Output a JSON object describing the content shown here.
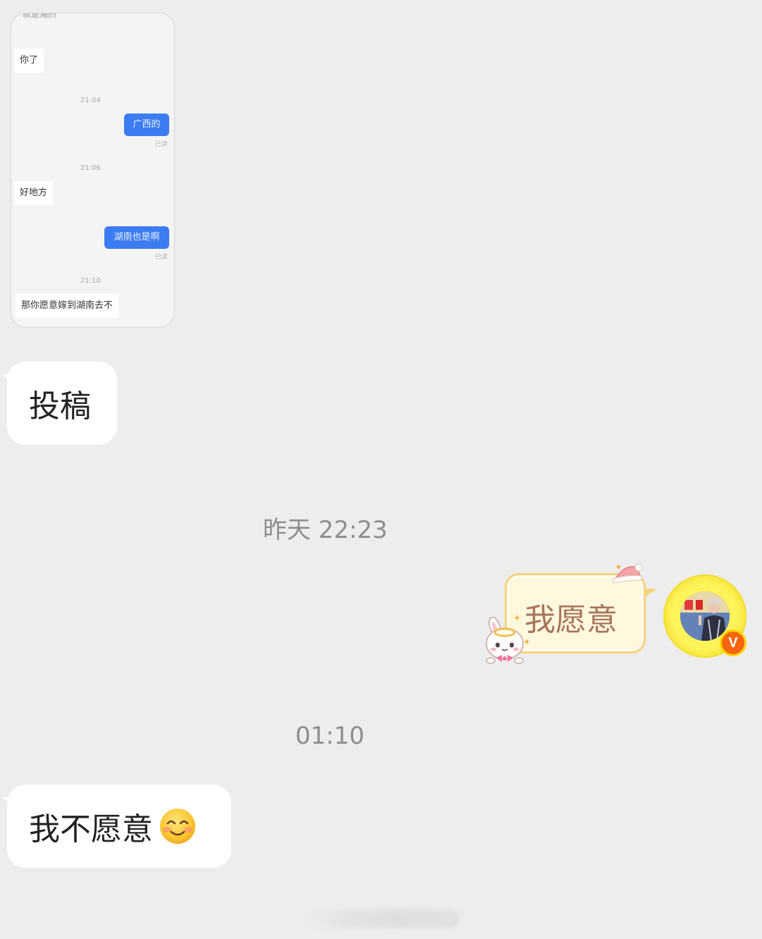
{
  "shared_screenshot": {
    "cut_top_text": "就是湘的",
    "messages": [
      {
        "type": "in",
        "text": "你了"
      },
      {
        "type": "time",
        "text": "21:04"
      },
      {
        "type": "out",
        "text": "广西的",
        "status": "已读"
      },
      {
        "type": "time",
        "text": "21:06"
      },
      {
        "type": "in",
        "text": "好地方"
      },
      {
        "type": "out",
        "text": "湖南也是啊",
        "status": "已读"
      },
      {
        "type": "time",
        "text": "21:10"
      },
      {
        "type": "in",
        "text": "那你愿意嫁到湖南去不"
      }
    ]
  },
  "messages": [
    {
      "type": "in",
      "text": "投稿"
    },
    {
      "type": "time",
      "text": "昨天 22:23"
    },
    {
      "type": "out",
      "text": "我愿意"
    },
    {
      "type": "time",
      "text": "01:10"
    },
    {
      "type": "in",
      "text": "我不愿意"
    }
  ],
  "avatar": {
    "badge": "V"
  },
  "colors": {
    "background": "#ededed",
    "bubble_in": "#ffffff",
    "screenshot_blue": "#3b7cf3",
    "fancy_border": "#f7d27a",
    "fancy_text": "#a6745e",
    "badge_orange": "#f5650b"
  },
  "icons": [
    "smiling-face-emoji-icon",
    "bunny-sticker-icon",
    "party-hat-icon",
    "verified-v-icon"
  ]
}
